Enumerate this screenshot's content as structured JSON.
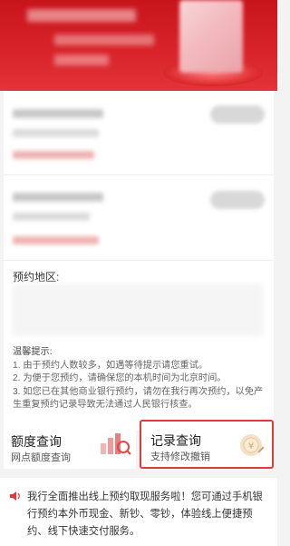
{
  "region": {
    "label": "预约地区:"
  },
  "tips": {
    "title": "温馨提示:",
    "items": [
      "1. 由于预约人数较多，如遇等待提示请您重试。",
      "2. 为便于您预约，请确保您的本机时间为北京时间。",
      "3. 如您已在其他商业银行预约，请勿在我行再次预约，以免产生重复预约记录导致无法通过人民银行核查。"
    ]
  },
  "tiles": [
    {
      "title": "额度查询",
      "subtitle": "网点额度查询",
      "icon": "bar-chart-icon"
    },
    {
      "title": "记录查询",
      "subtitle": "支持修改撤销",
      "icon": "coin-icon"
    }
  ],
  "notice": {
    "icon": "speaker-icon",
    "text": "我行全面推出线上预约取现服务啦！您可通过手机银行预约本外币现金、新钞、零钞，体验线上便捷预约、线下快速交付服务。"
  },
  "colors": {
    "brand_red": "#d8242a",
    "highlight_border": "#e23a3a"
  }
}
